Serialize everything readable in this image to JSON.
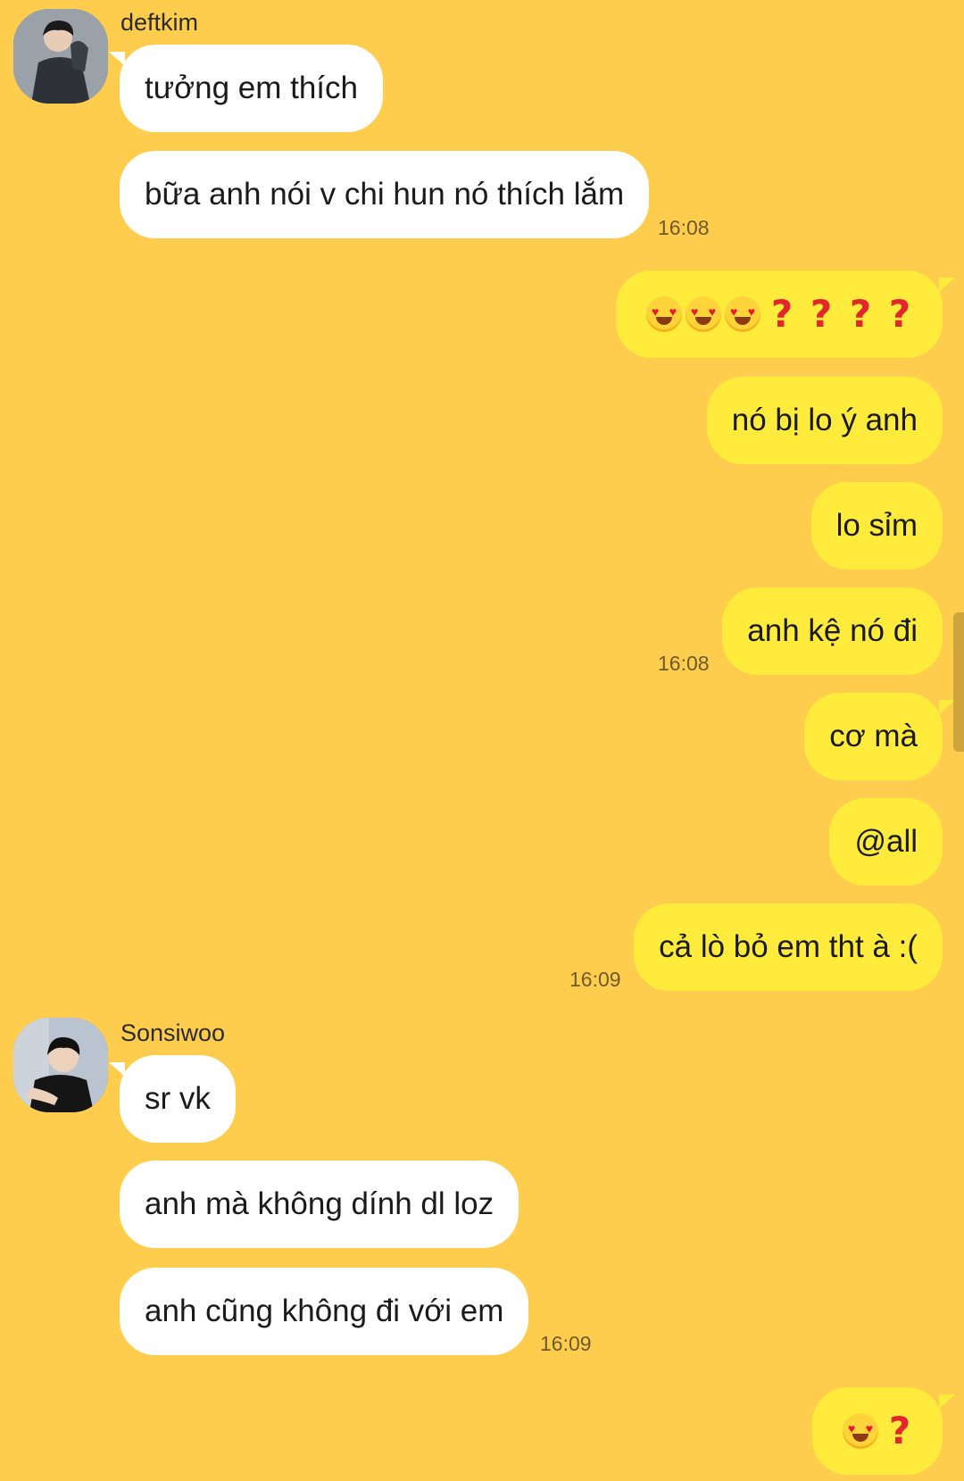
{
  "colors": {
    "background": "#FFCD4D",
    "incoming_bubble": "#FFFFFF",
    "outgoing_bubble": "#FFEB3B"
  },
  "messages": [
    {
      "sender": "deftkim",
      "direction": "in",
      "text": "tưởng em thích"
    },
    {
      "direction": "in",
      "text": "bữa anh nói v chi hun nó thích lắm",
      "time": "16:08"
    },
    {
      "direction": "out",
      "emoji": [
        "heart-eyes",
        "heart-eyes",
        "heart-eyes",
        "question",
        "question",
        "question",
        "question"
      ]
    },
    {
      "direction": "out",
      "text": "nó bị lo ý anh"
    },
    {
      "direction": "out",
      "text": "lo sỉm"
    },
    {
      "direction": "out",
      "text": "anh kệ nó đi",
      "time": "16:08"
    },
    {
      "direction": "out",
      "text": "cơ mà"
    },
    {
      "direction": "out",
      "text": "@all"
    },
    {
      "direction": "out",
      "text": "cả lò bỏ em tht à :(",
      "time": "16:09"
    },
    {
      "sender": "Sonsiwoo",
      "direction": "in",
      "text": "sr vk"
    },
    {
      "direction": "in",
      "text": "anh mà không dính dl loz"
    },
    {
      "direction": "in",
      "text": "anh cũng không đi với em",
      "time": "16:09"
    },
    {
      "direction": "out",
      "emoji": [
        "heart-eyes",
        "question"
      ]
    }
  ]
}
